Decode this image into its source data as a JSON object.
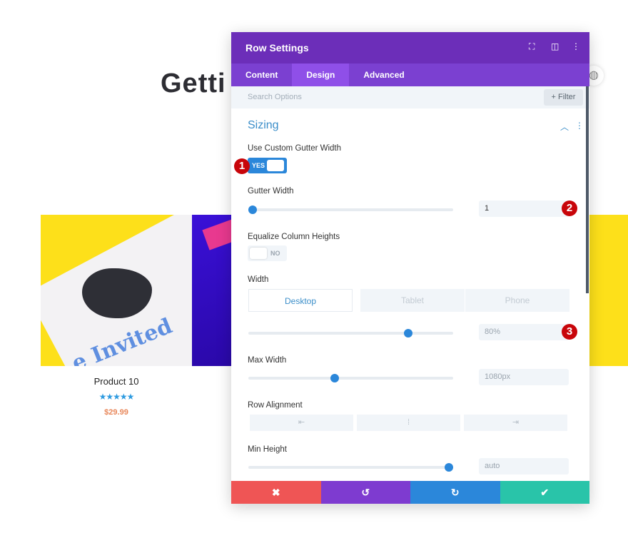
{
  "background": {
    "heading": "Getti",
    "product": {
      "name": "Product 10",
      "rating_stars": 5,
      "rating_glyphs": "★★★★★",
      "price": "$29.99",
      "image_text": "e Invited"
    }
  },
  "panel": {
    "title": "Row Settings",
    "header_icons": [
      "fullscreen-icon",
      "split-view-icon",
      "more-vertical-icon"
    ],
    "tabs": [
      {
        "label": "Content"
      },
      {
        "label": "Design",
        "active": true
      },
      {
        "label": "Advanced"
      }
    ],
    "search_placeholder": "Search Options",
    "filter_label": "+ Filter",
    "section_title": "Sizing",
    "custom_gutter": {
      "label": "Use Custom Gutter Width",
      "value": "YES"
    },
    "gutter_width": {
      "label": "Gutter Width",
      "value": "1",
      "slider_percent": 2
    },
    "equalize": {
      "label": "Equalize Column Heights",
      "value": "NO"
    },
    "width": {
      "label": "Width",
      "devices": [
        "Desktop",
        "Tablet",
        "Phone"
      ],
      "active_device": "Desktop",
      "value": "80%",
      "slider_percent": 78
    },
    "max_width": {
      "label": "Max Width",
      "value": "1080px",
      "slider_percent": 42
    },
    "row_alignment": {
      "label": "Row Alignment",
      "options": [
        "⇤",
        "⁞",
        "⇥"
      ]
    },
    "min_height": {
      "label": "Min Height",
      "value": "auto",
      "slider_percent": 98
    },
    "footer": {
      "cancel": "✖",
      "undo": "↺",
      "redo": "↻",
      "save": "✔"
    },
    "colors": {
      "header": "#6c2eb9",
      "accent": "#2b87da",
      "cancel": "#ef5555",
      "undo": "#7e3bd0",
      "redo": "#2b87da",
      "save": "#29c4a9"
    }
  },
  "annotations": [
    "1",
    "2",
    "3"
  ]
}
